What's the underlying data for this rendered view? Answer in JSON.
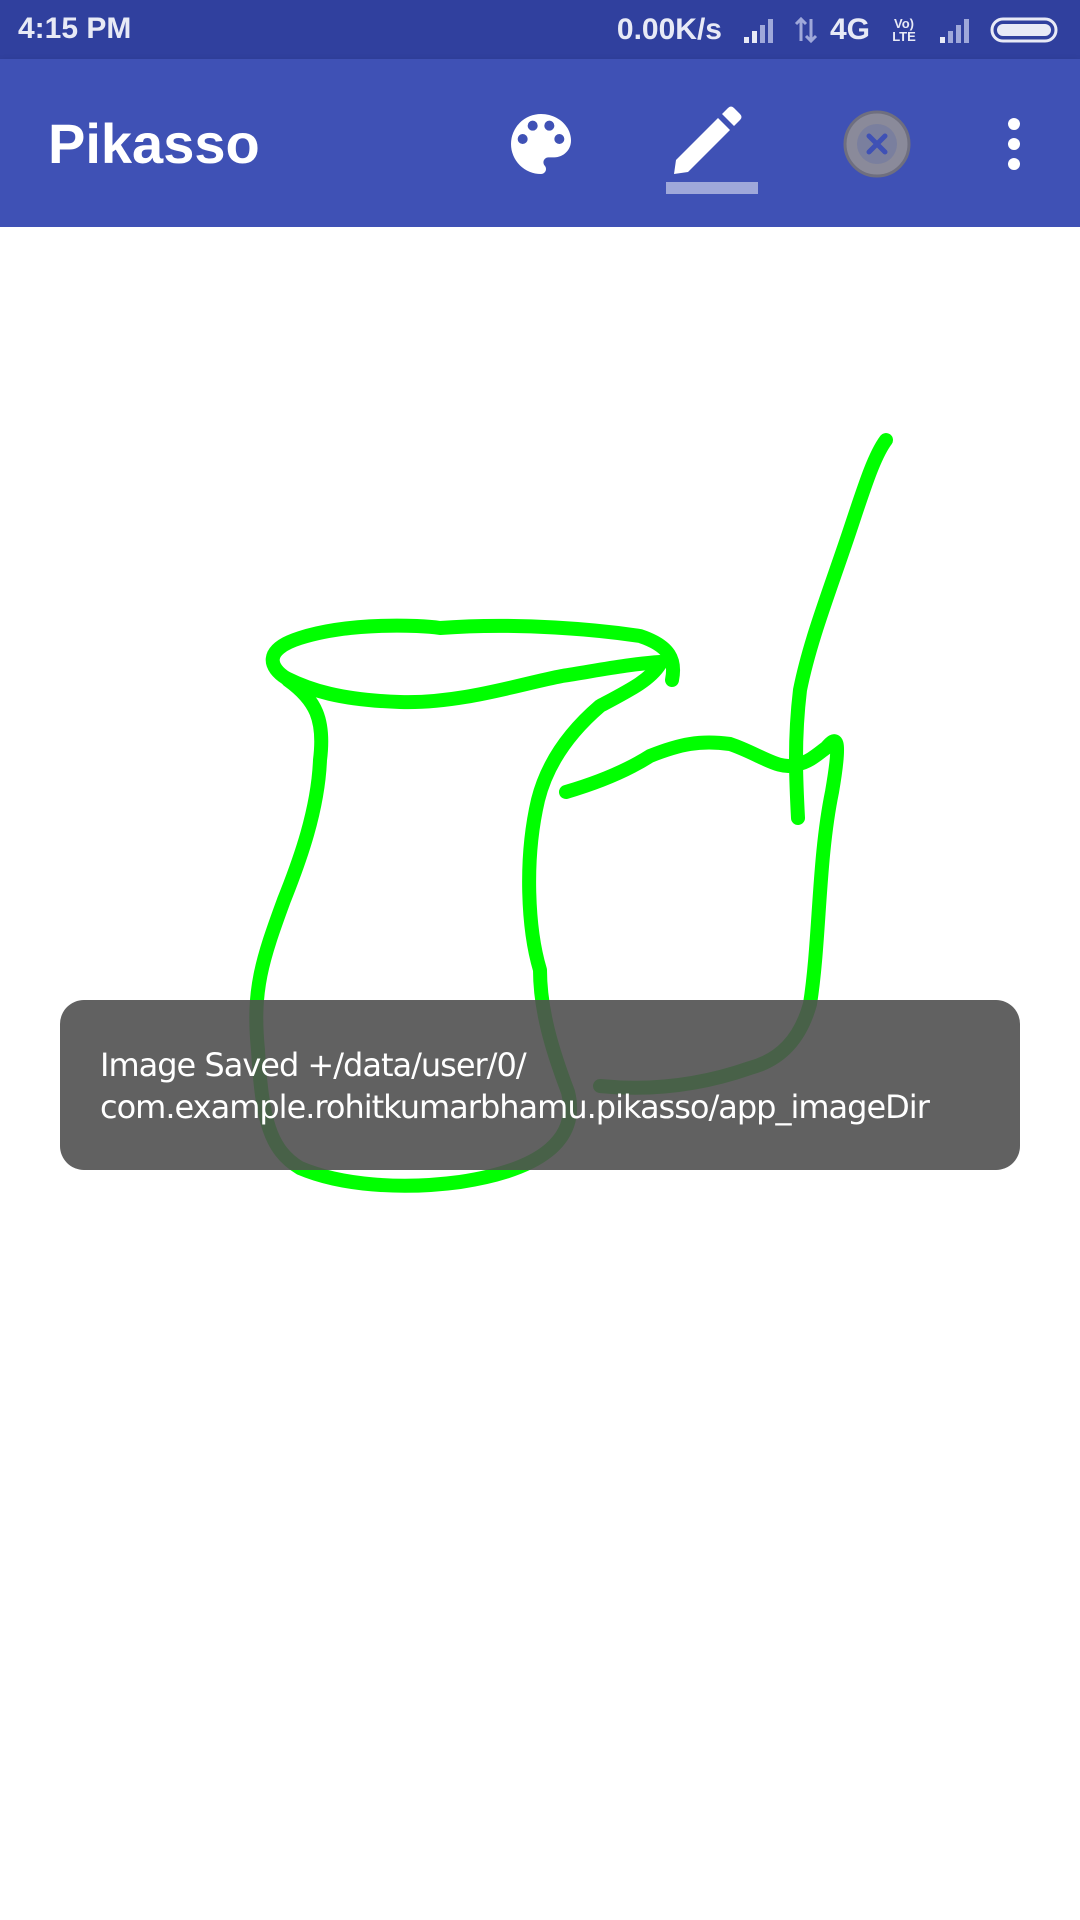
{
  "status_bar": {
    "time": "4:15 PM",
    "net_speed": "0.00K/s",
    "network_type": "4G",
    "volte_top": "Vo)",
    "volte_bottom": "LTE"
  },
  "app_bar": {
    "title": "Pikasso",
    "actions": [
      {
        "name": "palette-icon"
      },
      {
        "name": "pencil-icon",
        "selected": true
      },
      {
        "name": "clear-icon"
      },
      {
        "name": "overflow-menu-icon"
      }
    ]
  },
  "colors": {
    "status_bar": "#30409e",
    "app_bar": "#3f51b5",
    "stroke": "#00ff00",
    "toast": "#505050"
  },
  "toast": {
    "line1": "Image Saved +/data/user/0/",
    "line2": "com.example.rohitkumarbhamu.pikasso/app_imageDir"
  }
}
